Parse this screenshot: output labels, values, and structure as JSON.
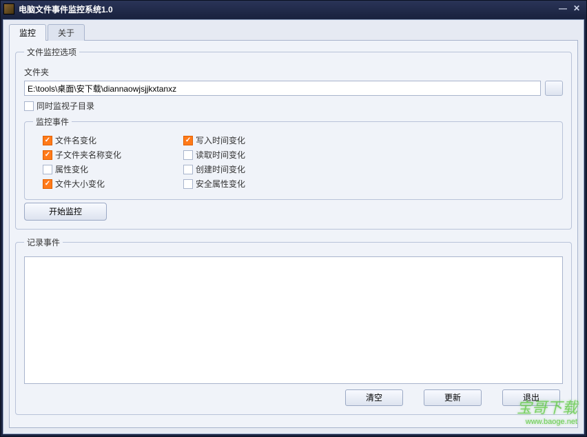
{
  "window": {
    "title": "电脑文件事件监控系统1.0"
  },
  "tabs": {
    "monitor": "监控",
    "about": "关于"
  },
  "options": {
    "legend": "文件监控选项",
    "folder_label": "文件夹",
    "folder_path": "E:\\tools\\桌面\\安下载\\diannaowjsjjkxtanxz",
    "watch_sub": "同时监视子目录"
  },
  "events": {
    "legend": "监控事件",
    "col1": {
      "filename": "文件名变化",
      "subfolder": "子文件夹名称变化",
      "attr": "属性变化",
      "size": "文件大小变化"
    },
    "col2": {
      "write_time": "写入时间变化",
      "read_time": "读取时间变化",
      "create_time": "创建时间变化",
      "security": "安全属性变化"
    }
  },
  "start_button": "开始监控",
  "log": {
    "legend": "记录事件"
  },
  "buttons": {
    "clear": "清空",
    "refresh": "更新",
    "exit": "退出"
  },
  "watermark": {
    "text": "宝哥下载",
    "url": "www.baoge.net"
  }
}
